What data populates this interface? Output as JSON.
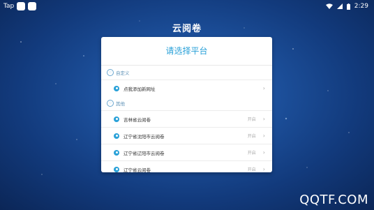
{
  "status_bar": {
    "left_text": "Tap",
    "time": "2:29",
    "icons": [
      "wifi-icon",
      "signal-icon",
      "battery-icon"
    ]
  },
  "app": {
    "title": "云阅卷"
  },
  "dialog": {
    "title": "请选择平台",
    "sections": [
      {
        "label": "自定义",
        "items": [
          {
            "label": "点我添加新网址",
            "status": ""
          }
        ]
      },
      {
        "label": "其他",
        "items": [
          {
            "label": "吉林省云阅卷",
            "status": "开启"
          },
          {
            "label": "辽宁省沈阳市云阅卷",
            "status": "开启"
          },
          {
            "label": "辽宁省辽阳市云阅卷",
            "status": "开启"
          },
          {
            "label": "辽宁省云阅卷",
            "status": "开启"
          }
        ]
      }
    ]
  },
  "watermark": "QQTF.COM",
  "colors": {
    "accent": "#2aa1d8",
    "background": "#1c4f9a"
  }
}
